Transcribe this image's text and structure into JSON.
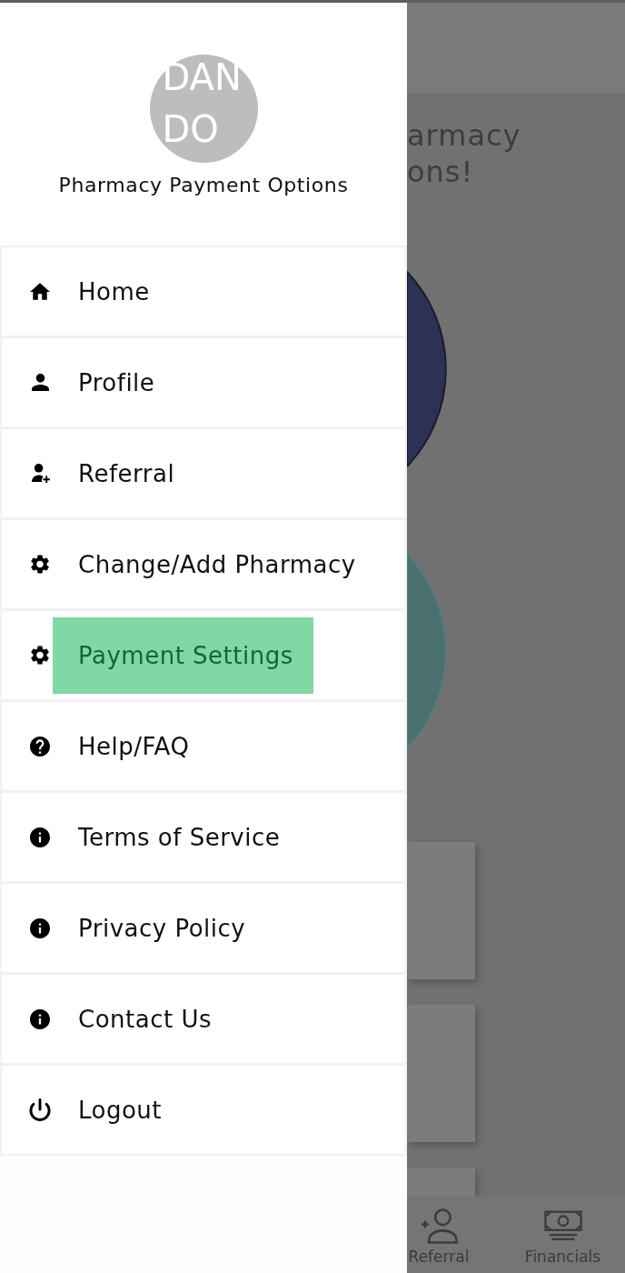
{
  "drawer": {
    "avatar": {
      "initials": "DAN DO"
    },
    "title": "Pharmacy Payment Options",
    "menu": [
      {
        "label": "Home",
        "highlighted": false
      },
      {
        "label": "Profile",
        "highlighted": false
      },
      {
        "label": "Referral",
        "highlighted": false
      },
      {
        "label": "Change/Add Pharmacy",
        "highlighted": false
      },
      {
        "label": "Payment Settings",
        "highlighted": true
      },
      {
        "label": "Help/FAQ",
        "highlighted": false
      },
      {
        "label": "Terms of Service",
        "highlighted": false
      },
      {
        "label": "Privacy Policy",
        "highlighted": false
      },
      {
        "label": "Contact Us",
        "highlighted": false
      },
      {
        "label": "Logout",
        "highlighted": false
      }
    ]
  },
  "background": {
    "heading_lines": [
      "armacy",
      "ons!"
    ],
    "circles": [
      {
        "color": "#2d3153"
      },
      {
        "color": "#4a6f6f"
      }
    ],
    "bottom_nav": [
      {
        "label": "Referral"
      },
      {
        "label": "Financials"
      }
    ]
  }
}
